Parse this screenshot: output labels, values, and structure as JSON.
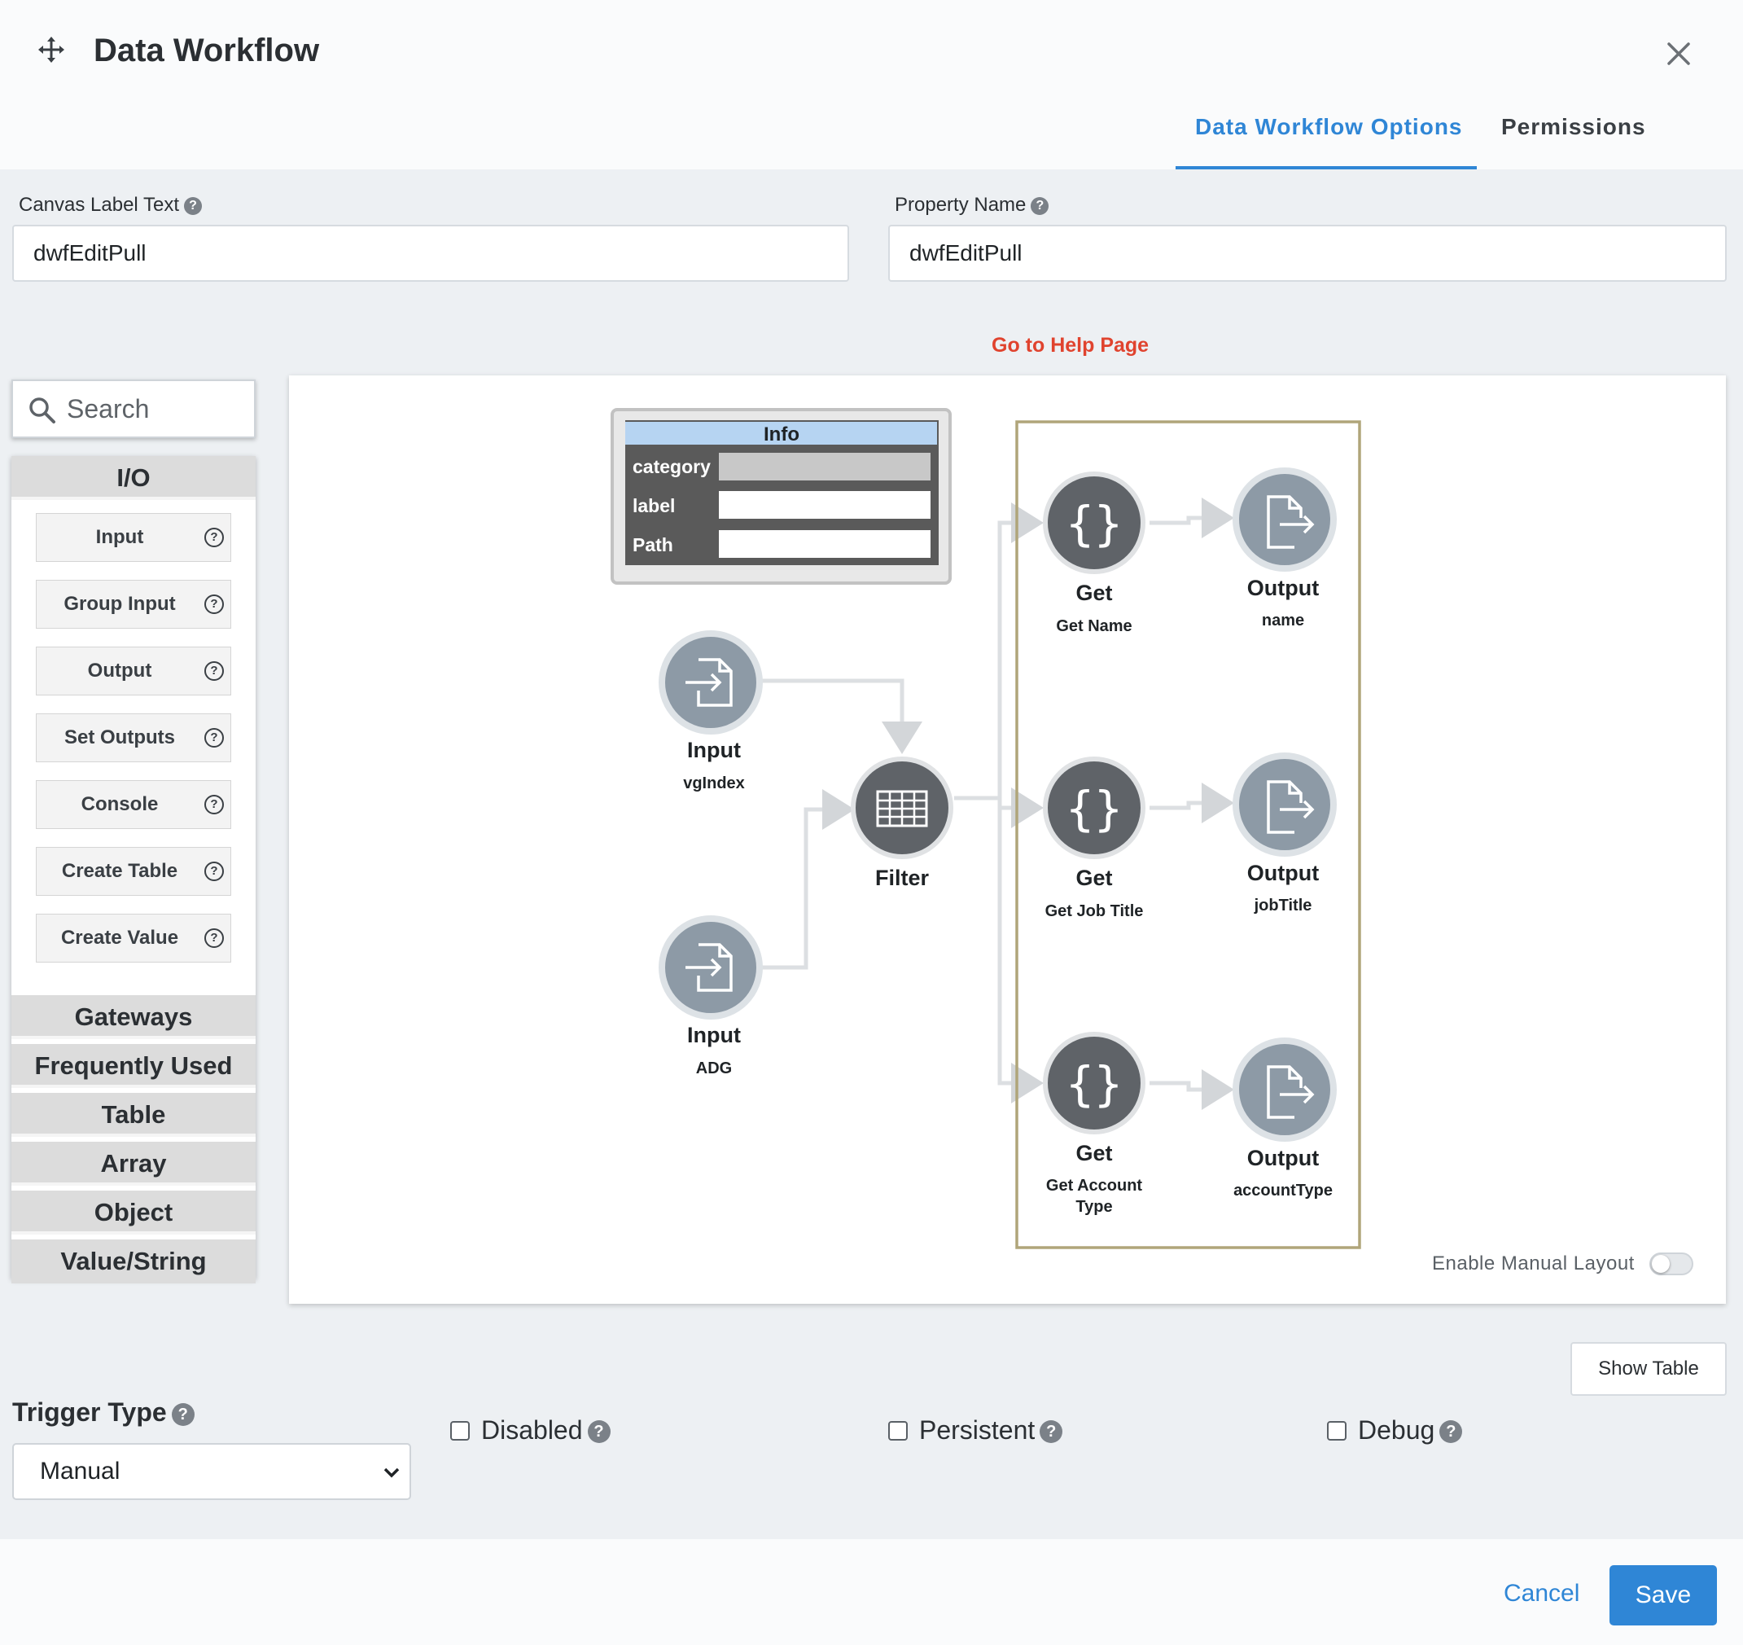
{
  "header": {
    "title": "Data Workflow",
    "move_icon": "move-arrows-icon",
    "close_icon": "close-icon",
    "tabs": [
      {
        "label": "Data Workflow Options",
        "active": true
      },
      {
        "label": "Permissions",
        "active": false
      }
    ]
  },
  "form": {
    "canvas_label": {
      "label": "Canvas Label Text",
      "value": "dwfEditPull"
    },
    "property_name": {
      "label": "Property Name",
      "value": "dwfEditPull"
    },
    "help_link": "Go to Help Page"
  },
  "palette": {
    "search_placeholder": "Search",
    "io_header": "I/O",
    "io_items": [
      "Input",
      "Group Input",
      "Output",
      "Set Outputs",
      "Console",
      "Create Table",
      "Create Value"
    ],
    "categories": [
      "Gateways",
      "Frequently Used",
      "Table",
      "Array",
      "Object",
      "Value/String"
    ]
  },
  "canvas": {
    "info_panel": {
      "title": "Info",
      "rows": [
        {
          "key": "category",
          "value": ""
        },
        {
          "key": "label",
          "value": ""
        },
        {
          "key": "Path",
          "value": ""
        }
      ]
    },
    "nodes": {
      "input_vgindex": {
        "type": "Input",
        "label": "vgIndex"
      },
      "input_adg": {
        "type": "Input",
        "label": "ADG"
      },
      "filter": {
        "type": "Filter",
        "label": ""
      },
      "get_name": {
        "type": "Get",
        "label": "Get Name"
      },
      "get_job_title": {
        "type": "Get",
        "label": "Get Job Title"
      },
      "get_account_type": {
        "type": "Get",
        "label_line1": "Get Account",
        "label_line2": "Type"
      },
      "output_name": {
        "type": "Output",
        "label": "name"
      },
      "output_job_title": {
        "type": "Output",
        "label": "jobTitle"
      },
      "output_account_type": {
        "type": "Output",
        "label": "accountType"
      }
    },
    "manual_layout_label": "Enable Manual Layout",
    "manual_layout_enabled": false
  },
  "show_table_label": "Show Table",
  "trigger": {
    "label": "Trigger Type",
    "value": "Manual"
  },
  "checkboxes": [
    {
      "label": "Disabled",
      "checked": false
    },
    {
      "label": "Persistent",
      "checked": false
    },
    {
      "label": "Debug",
      "checked": false
    }
  ],
  "footer": {
    "cancel_label": "Cancel",
    "save_label": "Save"
  },
  "colors": {
    "accent": "#2f86d6",
    "help_link": "#e0432e",
    "node_get": "#5f6368",
    "node_io": "#8d9aa6",
    "group_border": "#b0a57a"
  }
}
